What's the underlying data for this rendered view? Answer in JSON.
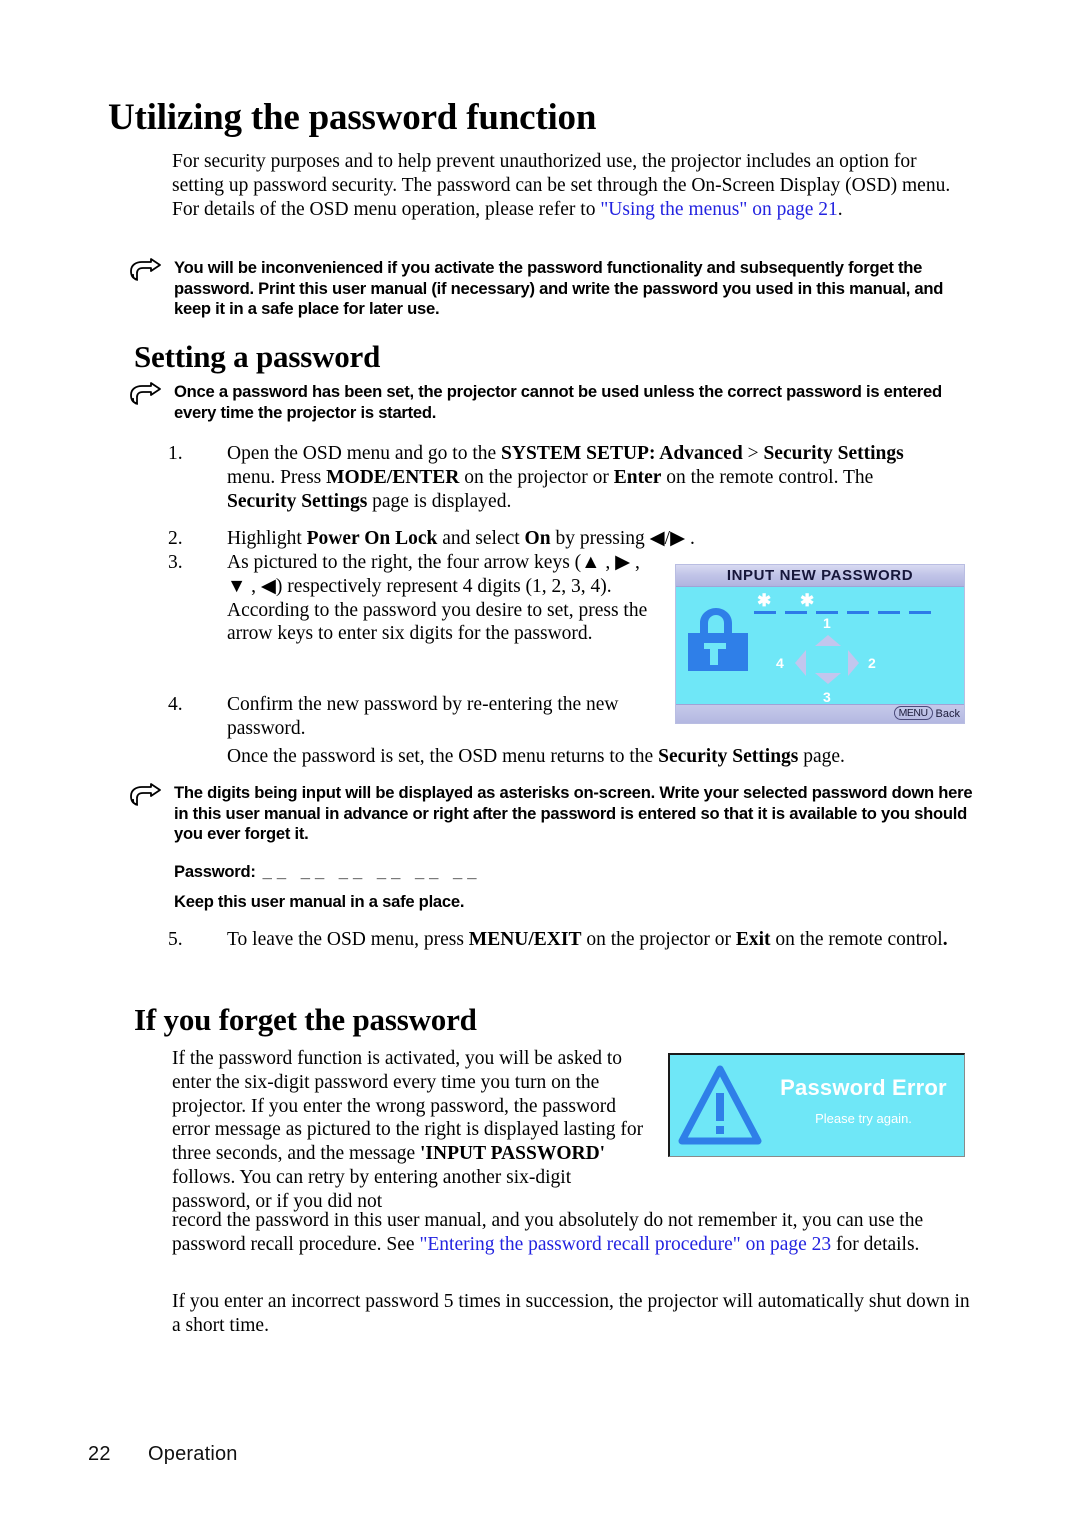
{
  "document": {
    "heading1": "Utilizing the password function",
    "intro_before_link": "For security purposes and to help prevent unauthorized use, the projector includes an option for setting up password security. The password can be set through the On-Screen Display (OSD) menu. For details of the OSD menu operation, please refer to ",
    "intro_link": "\"Using the menus\" on page 21",
    "intro_after_link": ".",
    "note1": "You will be inconvenienced if you activate the password functionality and subsequently forget the password. Print this user manual (if necessary) and write the password you used in this manual, and keep it in a safe place for later use.",
    "heading2_setting": "Setting a password",
    "note2": "Once a password has been set, the projector cannot be used unless the correct password is entered every time the projector is started.",
    "steps": [
      {
        "num": "1.",
        "segments": [
          {
            "t": "Open the OSD menu and go to the ",
            "b": false
          },
          {
            "t": "SYSTEM SETUP: Advanced",
            "b": true
          },
          {
            "t": " > ",
            "b": false
          },
          {
            "t": "Security Settings",
            "b": true
          },
          {
            "t": " menu. Press ",
            "b": false
          },
          {
            "t": "MODE/ENTER",
            "b": true
          },
          {
            "t": " on the projector or ",
            "b": false
          },
          {
            "t": "Enter",
            "b": true
          },
          {
            "t": " on the remote control. The ",
            "b": false
          },
          {
            "t": "Security Settings",
            "b": true
          },
          {
            "t": " page is displayed.",
            "b": false
          }
        ]
      },
      {
        "num": "2.",
        "segments": [
          {
            "t": "Highlight ",
            "b": false
          },
          {
            "t": "Power On Lock",
            "b": true
          },
          {
            "t": " and select ",
            "b": false
          },
          {
            "t": "On",
            "b": true
          },
          {
            "t": " by pressing ◀/▶ .",
            "b": false
          }
        ]
      },
      {
        "num": "3.",
        "segments": [
          {
            "t": "As pictured to the right, the four arrow keys (▲ , ▶ , ▼ , ◀) respectively represent 4 digits (1, 2, 3, 4). According to the password you desire to set, press the arrow keys to enter six digits for the password.",
            "b": false
          }
        ]
      },
      {
        "num": "4.",
        "segments": [
          {
            "t": "Confirm the new password by re-entering the new password.",
            "b": false
          }
        ]
      }
    ],
    "after_step4_before_bold": "Once the password is set, the OSD menu returns to the ",
    "after_step4_bold": "Security Settings",
    "after_step4_tail": " page.",
    "note3": "The digits being input will be displayed as asterisks on-screen. Write your selected password down here in this user manual in advance or right after the password is entered so that it is available to you should you ever forget it.",
    "password_label": "Password:",
    "password_blanks": "__ __ __ __ __ __",
    "keep_safe": "Keep this user manual in a safe place.",
    "step5": {
      "num": "5.",
      "segments": [
        {
          "t": "To leave the OSD menu, press ",
          "b": false
        },
        {
          "t": "MENU/EXIT",
          "b": true
        },
        {
          "t": " on the projector or ",
          "b": false
        },
        {
          "t": "Exit",
          "b": true
        },
        {
          "t": " on the remote control",
          "b": false
        },
        {
          "t": ".",
          "b": true
        }
      ]
    },
    "heading2_forget": "If you forget the password",
    "forget_para1_segments": [
      {
        "t": "If the password function is activated, you will be asked to enter the six-digit password every time you turn on the projector. If you enter the wrong password, the password error message as pictured to the right is displayed lasting for three seconds, and the message ",
        "b": false
      },
      {
        "t": "'INPUT PASSWORD'",
        "b": true
      },
      {
        "t": " follows. You can retry by entering another six-digit password, or if you did not",
        "b": false
      }
    ],
    "forget_para2_before_link": "record the password in this user manual, and you absolutely do not remember it, you can use the password recall procedure. See ",
    "forget_para2_link": "\"Entering the password recall procedure\" on page 23",
    "forget_para2_after_link": " for details.",
    "forget_para3": "If you enter an incorrect password 5 times in succession, the projector will automatically shut down in a short time.",
    "footer": {
      "page_number": "22",
      "section": "Operation"
    }
  },
  "osd_input_password": {
    "title": "INPUT NEW PASSWORD",
    "entered_asterisks": "✱ ✱",
    "digit_slots": 6,
    "filled_slots": 2,
    "arrow_labels": {
      "up": "1",
      "right": "2",
      "down": "3",
      "left": "4"
    },
    "footer_key": "MENU",
    "footer_action": "Back",
    "colors": {
      "body": "#6FE7F7",
      "titlebar": "#C2C5E8",
      "accent_blue": "#2D7BE8",
      "arrow": "#C3C6EE"
    }
  },
  "osd_password_error": {
    "title": "Password Error",
    "subtitle": "Please try again.",
    "icon": "warning-triangle",
    "colors": {
      "body": "#6FE7F7",
      "icon": "#2D7BE8",
      "text": "#FFFFFF"
    }
  }
}
